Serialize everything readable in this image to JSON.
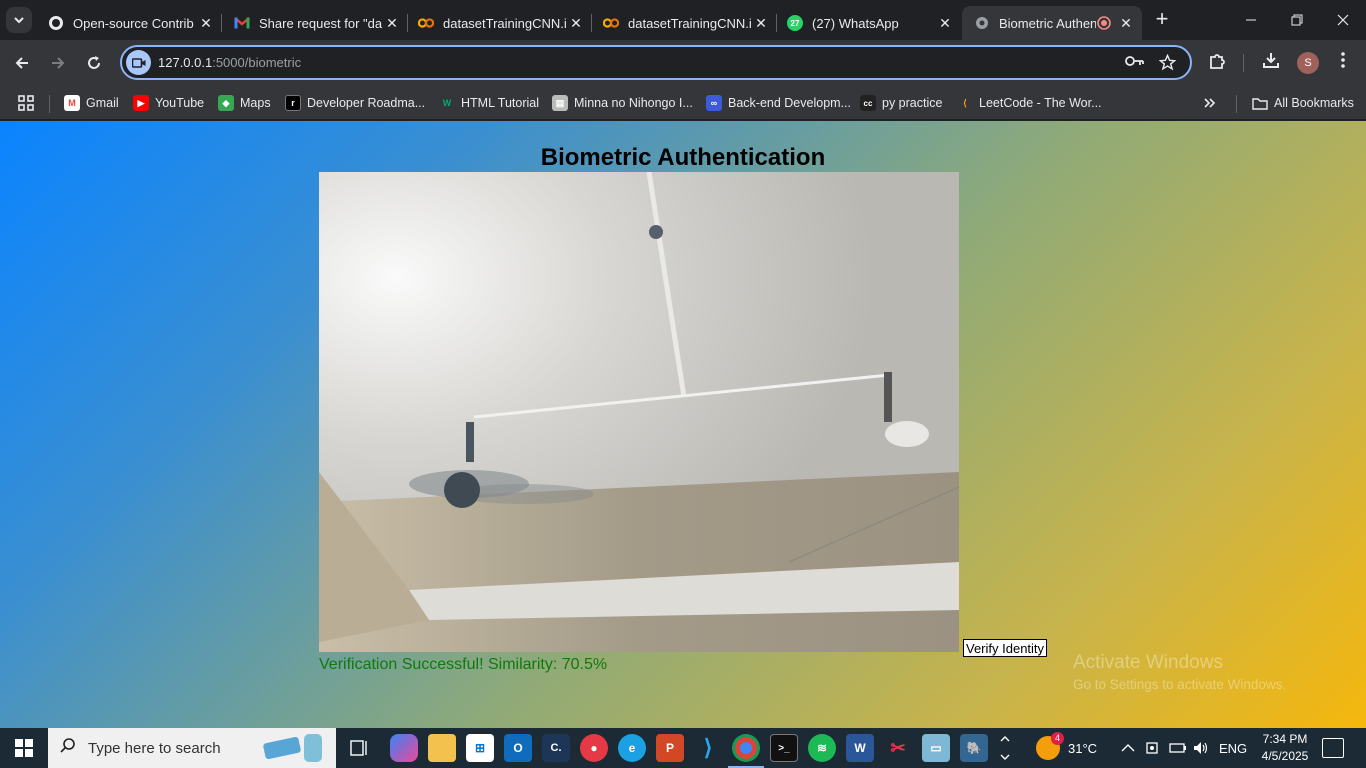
{
  "browser": {
    "tabs": [
      {
        "title": "Open-source Contrib",
        "icon": "github-icon",
        "active": false
      },
      {
        "title": "Share request for \"da",
        "icon": "gmail-icon",
        "active": false
      },
      {
        "title": "datasetTrainingCNN.i",
        "icon": "colab-icon",
        "active": false
      },
      {
        "title": "datasetTrainingCNN.i",
        "icon": "colab-icon",
        "active": false
      },
      {
        "title": "(27) WhatsApp",
        "icon": "whatsapp-icon",
        "active": false,
        "badge": "27"
      },
      {
        "title": "Biometric Authen",
        "icon": "globe-icon",
        "active": true
      }
    ],
    "address": {
      "host": "127.0.0.1",
      "path": ":5000/biometric"
    },
    "bookmarks": [
      {
        "label": "Gmail",
        "icon": "gmail-icon"
      },
      {
        "label": "YouTube",
        "icon": "youtube-icon"
      },
      {
        "label": "Maps",
        "icon": "maps-icon"
      },
      {
        "label": "Developer Roadma...",
        "icon": "roadmap-icon"
      },
      {
        "label": "HTML Tutorial",
        "icon": "w3schools-icon"
      },
      {
        "label": "Minna no Nihongo I...",
        "icon": "book-icon"
      },
      {
        "label": "Back-end Developm...",
        "icon": "meta-icon"
      },
      {
        "label": "py practice",
        "icon": "cc-icon"
      },
      {
        "label": "LeetCode - The Wor...",
        "icon": "leetcode-icon"
      }
    ],
    "all_bookmarks": "All Bookmarks",
    "profile_initial": "S"
  },
  "page": {
    "title": "Biometric Authentication",
    "verify_button": "Verify Identity",
    "result": "Verification Successful! Similarity: 70.5%",
    "watermark_title": "Activate Windows",
    "watermark_sub": "Go to Settings to activate Windows."
  },
  "taskbar": {
    "search_placeholder": "Type here to search",
    "weather": "31°C",
    "weather_badge": "4",
    "language": "ENG",
    "time": "7:34 PM",
    "date": "4/5/2025"
  },
  "colors": {
    "success": "#0f7a0f",
    "accent": "#8ab4f8",
    "gradient_start": "#0a84ff",
    "gradient_end": "#f5b70c"
  }
}
